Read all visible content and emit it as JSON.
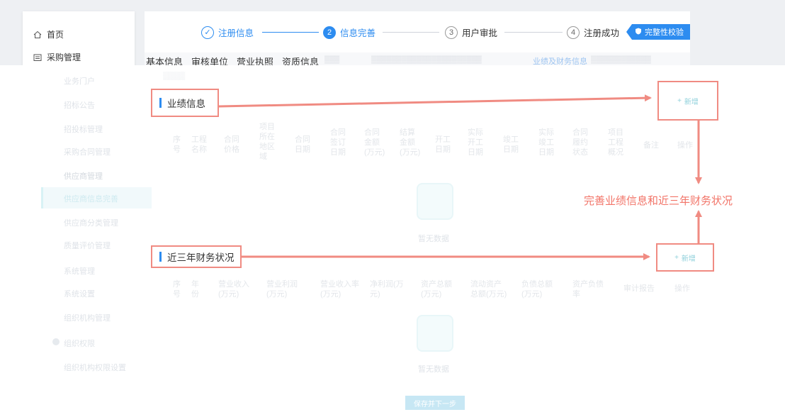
{
  "sidebar": {
    "items": [
      {
        "label": "首页",
        "icon": "home-icon"
      },
      {
        "label": "采购管理",
        "icon": "procurement-icon"
      }
    ],
    "faded_items": [
      "业务门户",
      "招标公告",
      "招投标管理",
      "采购合同管理",
      "供应商管理",
      "供应商信息完善",
      "供应商分类管理",
      "质量评价管理",
      "系统管理",
      "系统设置",
      "组织机构管理",
      "组织权限",
      "组织机构权限设置"
    ]
  },
  "steps": [
    {
      "num": "✓",
      "label": "注册信息",
      "state": "done"
    },
    {
      "num": "2",
      "label": "信息完善",
      "state": "active"
    },
    {
      "num": "3",
      "label": "用户审批",
      "state": "pending"
    },
    {
      "num": "4",
      "label": "注册成功",
      "state": "pending"
    }
  ],
  "check_button": "完整性校验",
  "tabs": [
    "基本信息",
    "审核单位",
    "营业执照",
    "资质信息"
  ],
  "selected_tab": "业绩及财务信息",
  "sections": {
    "performance": {
      "title": "业绩信息",
      "add_label": "新增"
    },
    "finance": {
      "title": "近三年财务状况",
      "add_label": "新增"
    }
  },
  "annotation": "完善业绩信息和近三年财务状况",
  "empty_text": "暂无数据",
  "save_button": "保存并下一步",
  "colors": {
    "primary": "#2d8cf0",
    "annotation": "#f27468"
  }
}
